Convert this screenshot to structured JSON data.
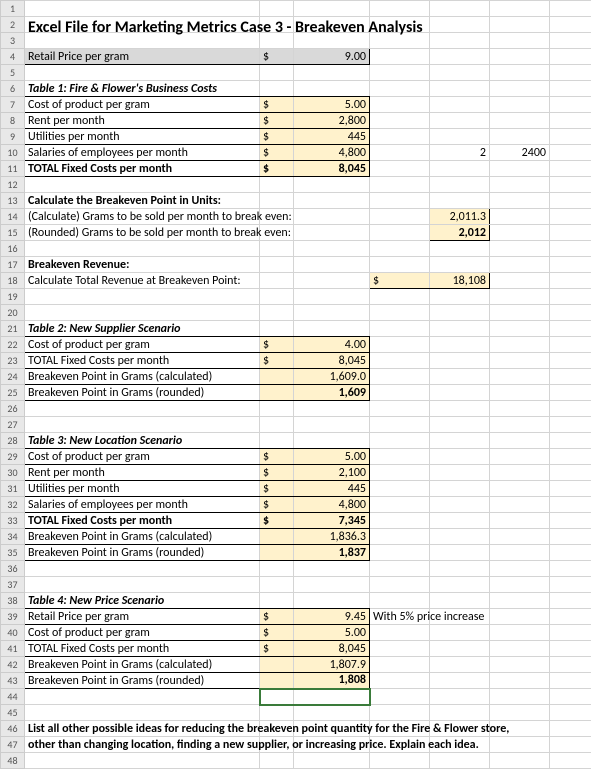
{
  "rows": [
    "1",
    "2",
    "3",
    "4",
    "5",
    "6",
    "7",
    "8",
    "9",
    "10",
    "11",
    "12",
    "13",
    "14",
    "15",
    "16",
    "17",
    "18",
    "19",
    "20",
    "21",
    "22",
    "23",
    "24",
    "25",
    "26",
    "27",
    "28",
    "29",
    "30",
    "31",
    "32",
    "33",
    "34",
    "35",
    "36",
    "37",
    "38",
    "39",
    "40",
    "41",
    "42",
    "43",
    "44",
    "45",
    "46",
    "47",
    "48"
  ],
  "title": "Excel File for Marketing Metrics Case 3 - Breakeven Analysis",
  "retail": {
    "label": "Retail Price per gram",
    "sym": "$",
    "val": "9.00"
  },
  "t1": {
    "header": "Table 1: Fire & Flower's Business Costs",
    "rows": [
      {
        "label": "Cost of product per gram",
        "sym": "$",
        "val": "5.00"
      },
      {
        "label": "Rent per month",
        "sym": "$",
        "val": "2,800"
      },
      {
        "label": "Utilities per month",
        "sym": "$",
        "val": "445"
      },
      {
        "label": "Salaries of employees per month",
        "sym": "$",
        "val": "4,800"
      },
      {
        "label": "TOTAL Fixed Costs per month",
        "sym": "$",
        "val": "8,045"
      }
    ],
    "side": {
      "a": "2",
      "b": "2400"
    }
  },
  "be": {
    "header": "Calculate the Breakeven Point in Units:",
    "r1label": "(Calculate) Grams to be sold per month to break even:",
    "r1val": "2,011.3",
    "r2label": "(Rounded) Grams to be sold per month to break even:",
    "r2val": "2,012"
  },
  "rev": {
    "header": "Breakeven Revenue:",
    "label": "Calculate Total Revenue at Breakeven Point:",
    "sym": "$",
    "val": "18,108"
  },
  "t2": {
    "header": "Table 2: New Supplier Scenario",
    "rows": [
      {
        "label": "Cost of product per gram",
        "sym": "$",
        "val": "4.00"
      },
      {
        "label": "TOTAL Fixed Costs per month",
        "sym": "$",
        "val": "8,045"
      },
      {
        "label": "Breakeven Point in Grams (calculated)",
        "sym": "",
        "val": "1,609.0"
      },
      {
        "label": "Breakeven Point in Grams (rounded)",
        "sym": "",
        "val": "1,609"
      }
    ]
  },
  "t3": {
    "header": "Table 3: New Location Scenario",
    "rows": [
      {
        "label": "Cost of product per gram",
        "sym": "$",
        "val": "5.00"
      },
      {
        "label": "Rent per month",
        "sym": "$",
        "val": "2,100"
      },
      {
        "label": "Utilities per month",
        "sym": "$",
        "val": "445"
      },
      {
        "label": "Salaries of employees per month",
        "sym": "$",
        "val": "4,800"
      },
      {
        "label": "TOTAL Fixed Costs per month",
        "sym": "$",
        "val": "7,345"
      },
      {
        "label": "Breakeven Point in Grams (calculated)",
        "sym": "",
        "val": "1,836.3"
      },
      {
        "label": "Breakeven Point in Grams (rounded)",
        "sym": "",
        "val": "1,837"
      }
    ]
  },
  "t4": {
    "header": "Table 4: New Price Scenario",
    "rows": [
      {
        "label": "Retail Price per gram",
        "sym": "$",
        "val": "9.45"
      },
      {
        "label": "Cost of product per gram",
        "sym": "$",
        "val": "5.00"
      },
      {
        "label": "TOTAL Fixed Costs per month",
        "sym": "$",
        "val": "8,045"
      },
      {
        "label": "Breakeven Point in Grams (calculated)",
        "sym": "",
        "val": "1,807.9"
      },
      {
        "label": "Breakeven Point in Grams (rounded)",
        "sym": "",
        "val": "1,808"
      }
    ],
    "note": "With 5% price increase"
  },
  "footer": {
    "l1": "List all other possible ideas for reducing the breakeven point quantity for the Fire & Flower store,",
    "l2": "other than changing location, finding a new supplier, or increasing price. Explain each idea."
  }
}
